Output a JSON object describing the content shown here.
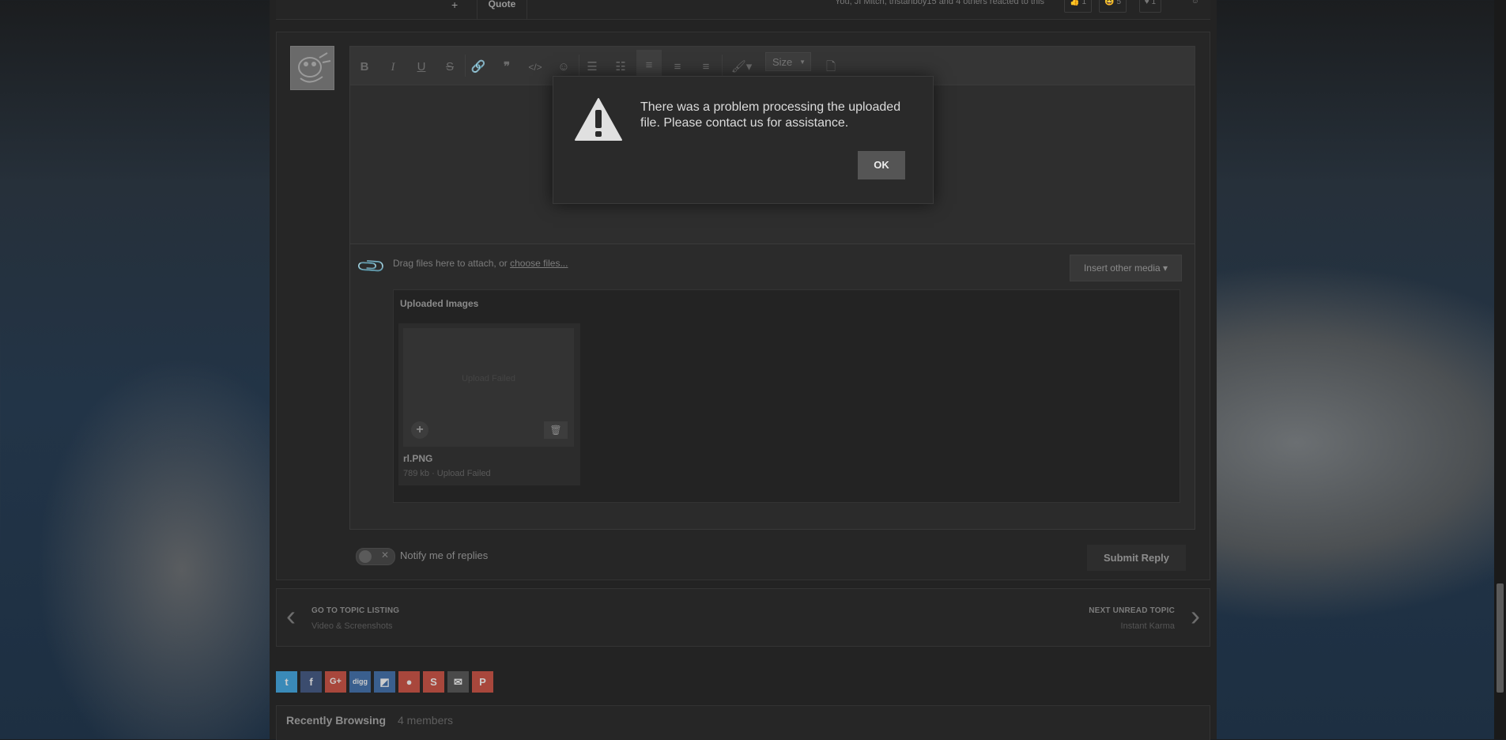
{
  "topbar": {
    "quote_label": "Quote",
    "reacted_text": "You, JI Mitch, tristanboy15 and 4 others reacted to this",
    "reactions": [
      {
        "icon": "thumbs-up-icon",
        "count": "1"
      },
      {
        "icon": "laugh-icon",
        "count": "5"
      },
      {
        "icon": "heart-icon",
        "count": "1"
      }
    ]
  },
  "editor": {
    "toolbar": {
      "size_label": "Size"
    },
    "attach_text": "Drag files here to attach, or",
    "choose_files": "choose files...",
    "insert_media": "Insert other media ▾",
    "uploaded_title": "Uploaded Images",
    "file": {
      "status_overlay": "Upload Failed",
      "name": "rl.PNG",
      "meta": "789 kb · Upload Failed"
    }
  },
  "footer": {
    "notify_label": "Notify me of replies",
    "submit_label": "Submit Reply"
  },
  "topic_nav": {
    "left_title": "GO TO TOPIC LISTING",
    "left_sub": "Video & Screenshots",
    "right_title": "NEXT UNREAD TOPIC",
    "right_sub": "Instant Karma"
  },
  "share": {
    "colors": {
      "twitter": "#3a8ab8",
      "facebook": "#3b4c6e",
      "googleplus": "#a8473c",
      "digg": "#3a5f8e",
      "delicious": "#3a5f8e",
      "reddit": "#a8473c",
      "stumbleupon": "#a8473c",
      "email": "#4a4a4a",
      "pinterest": "#a8473c"
    }
  },
  "recent": {
    "title": "Recently Browsing",
    "count": "4 members"
  },
  "modal": {
    "message": "There was a problem processing the uploaded file. Please contact us for assistance.",
    "ok_label": "OK"
  }
}
